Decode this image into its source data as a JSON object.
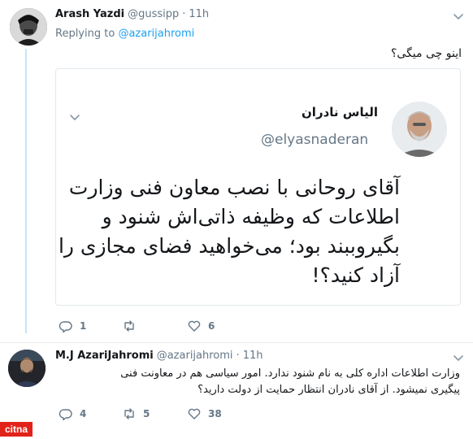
{
  "tweet1": {
    "name": "Arash Yazdi",
    "handle": "@gussipp",
    "time": "11h",
    "replying_prefix": "Replying to",
    "replying_handle": "@azarijahromi",
    "text": "اینو چی میگی؟"
  },
  "quoted": {
    "name": "الیاس نادران",
    "handle": "@elyasnaderan",
    "text_lines": [
      "آقای روحانی با نصب معاون فنی وزارت",
      "اطلاعات که وظیفه ذاتی‌اش شنود و",
      "بگیروببند بود؛ می‌خواهید فضای مجازی را",
      "آزاد کنید؟!"
    ]
  },
  "tweet1_actions": {
    "replies": "1",
    "retweets": "",
    "likes": "6"
  },
  "tweet2": {
    "name": "M.J AzariJahromi",
    "handle": "@azarijahromi",
    "time": "11h",
    "text_lines": [
      "وزارت اطلاعات اداره کلی به نام شنود ندارد. امور سیاسی هم در معاونت فنی",
      "پیگیری نمیشود. از آقای نادران انتظار حمایت از دولت دارید؟"
    ]
  },
  "tweet2_actions": {
    "replies": "4",
    "retweets": "5",
    "likes": "38"
  },
  "watermark": "citna",
  "colors": {
    "accent": "#1da1f2",
    "muted": "#657786",
    "thread": "#c7e4f4",
    "watermark": "#e2231a"
  },
  "icons": [
    "reply-icon",
    "retweet-icon",
    "like-icon",
    "chevron-down-icon"
  ]
}
